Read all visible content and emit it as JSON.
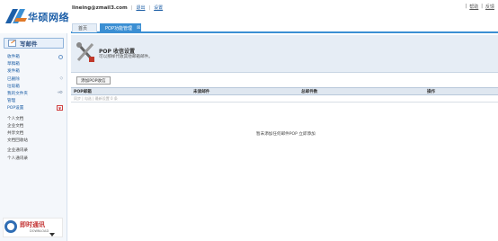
{
  "brand": {
    "name": "华硕网络"
  },
  "header": {
    "email": "lineing@zmail3.com",
    "links": [
      "退出",
      "设置"
    ],
    "top_right": [
      "帮助",
      "反馈"
    ]
  },
  "tabs": [
    {
      "label": "首页"
    },
    {
      "label": "POP功能管理",
      "close": "⊠"
    }
  ],
  "sidebar": {
    "compose_label": "写邮件",
    "items": [
      {
        "label": "收件箱"
      },
      {
        "label": "草稿箱"
      },
      {
        "label": "发件箱"
      },
      {
        "label": "已删除"
      },
      {
        "label": "垃圾箱"
      },
      {
        "label": "我的文件夹"
      },
      {
        "label": "管理"
      },
      {
        "label": "POP设置"
      },
      {
        "label": "个人文档"
      },
      {
        "label": "企业文档"
      },
      {
        "label": "共享文档"
      },
      {
        "label": "文档回收站"
      },
      {
        "label": "企业通讯录"
      },
      {
        "label": "个人通讯录"
      }
    ],
    "controls": {
      "folder_add": "+",
      "folder_gear": "⚙",
      "pop_arrow": "▼",
      "trash_clear": "◇"
    }
  },
  "im_banner": {
    "title": "即时通讯",
    "sub": "DOWNLOAD"
  },
  "main": {
    "title": "POP 收信设置",
    "subtitle": "可以那样代收其他邮箱邮件。",
    "add_button": "添加POP收信",
    "columns": [
      "POP邮箱",
      "未读邮件",
      "总邮件数",
      "操作"
    ],
    "toolbar_text": "同步 | 勾选 | 最新设置 0 条",
    "empty_message": "暂未添加任何邮件POP 立即添加"
  }
}
